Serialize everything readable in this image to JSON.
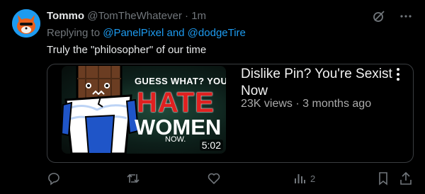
{
  "tweet": {
    "display_name": "Tommo",
    "handle": "@TomTheWhatever",
    "separator": "·",
    "time": "1m",
    "replying_prefix": "Replying to",
    "replying_mentions": "@PanelPixel and @dodgeTire",
    "text": "Truly the \"philosopher\" of our time"
  },
  "video_card": {
    "thumbnail_text": {
      "line1": "GUESS WHAT? YOU",
      "line2": "HATE",
      "line3": "WOMEN",
      "line4": "NOW."
    },
    "duration": "5:02",
    "title": "Dislike Pin? You're Sexist Now",
    "meta": "23K views · 3 months ago"
  },
  "actions": {
    "views_count": "2"
  },
  "icons": {
    "top_right": [
      "grok-icon",
      "more-icon"
    ],
    "action_bar": [
      "reply-icon",
      "retweet-icon",
      "like-icon",
      "views-icon",
      "bookmark-icon",
      "share-icon"
    ]
  },
  "colors": {
    "background": "#000000",
    "accent": "#1d9bf0",
    "muted": "#71767b",
    "text": "#e7e9ea",
    "thumbnail_red": "#e02020"
  }
}
